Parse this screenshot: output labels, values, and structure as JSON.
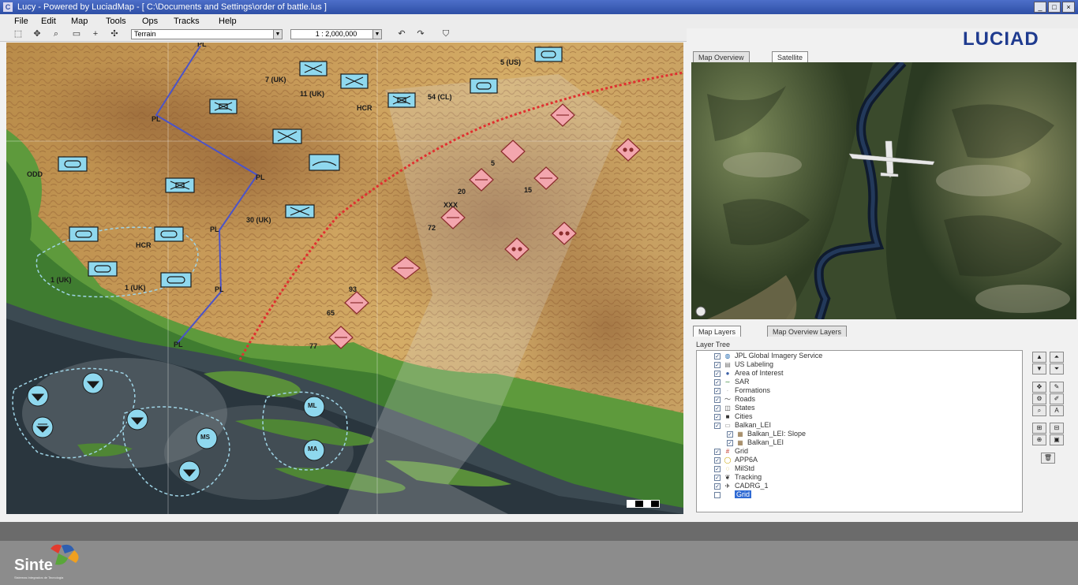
{
  "window": {
    "app_icon": "C",
    "title": "Lucy - Powered by LuciadMap - [ C:\\Documents and Settings\\order of battle.lus ]",
    "controls": [
      "_",
      "□",
      "×"
    ]
  },
  "menu": [
    "File",
    "Edit",
    "Map",
    "Tools",
    "Ops",
    "Tracks",
    "Help"
  ],
  "toolbar": {
    "layer_select": "Terrain",
    "scale_value": "1 : 2,000,000",
    "icons": [
      "select-arrow-icon",
      "pan-hand-icon",
      "zoom-magnifier-icon",
      "measure-icon",
      "crosshair-icon",
      "move-icon",
      "undo-icon",
      "redo-icon",
      "shield-icon"
    ]
  },
  "brand": {
    "logo": "LUCIAD",
    "logo_color": "#1f3b8f",
    "footer_logo": "Sinte",
    "footer_sub": "Sistemas Integrados de Tecnologia"
  },
  "map": {
    "labels": {
      "pl_top": "PL",
      "pl_1": "PL",
      "pl_2": "PL",
      "pl_3": "PL",
      "pl_4": "PL",
      "pl_bottom": "PL",
      "u_7uk": "7 (UK)",
      "u_11uk": "11 (UK)",
      "u_hcr1": "HCR",
      "u_54": "54 (CL)",
      "u_5us": "5 (US)",
      "u_odd": "ODD",
      "u_30uk": "30 (UK)",
      "u_hcr2": "HCR",
      "u_1uk_a": "1 (UK)",
      "u_1uk_b": "1 (UK)",
      "e_5": "5",
      "e_20": "20",
      "e_15": "15",
      "e_xxx": "XXX",
      "e_72": "72",
      "e_93": "93",
      "e_65": "65",
      "e_77": "77",
      "s_ml": "ML",
      "s_ms": "MS",
      "s_ma": "MA"
    },
    "colors": {
      "friendly": "#8fd8ee",
      "hostile": "#f3a6ae",
      "phase_line": "#4b53c8",
      "fscl": "#e03030"
    }
  },
  "right_panel": {
    "view_tabs": [
      "Map Overview",
      "Satellite"
    ],
    "active_view_tab": "Satellite",
    "layer_tabs": [
      "Map Layers",
      "Map Overview Layers"
    ],
    "active_layer_tab": "Map Layers",
    "tree_title": "Layer Tree",
    "layers": [
      {
        "label": "JPL Global Imagery Service",
        "icon": "globe-icon",
        "checked": true,
        "indent": 0
      },
      {
        "label": "US Labeling",
        "icon": "layer-icon",
        "checked": true,
        "indent": 0
      },
      {
        "label": "Area of Interest",
        "icon": "area-icon",
        "checked": true,
        "indent": 0
      },
      {
        "label": "SAR",
        "icon": "line-icon",
        "checked": true,
        "indent": 0
      },
      {
        "label": "Formations",
        "icon": "formation-icon",
        "checked": true,
        "indent": 0
      },
      {
        "label": "Roads",
        "icon": "road-icon",
        "checked": true,
        "indent": 0
      },
      {
        "label": "States",
        "icon": "states-icon",
        "checked": true,
        "indent": 0
      },
      {
        "label": "Cities",
        "icon": "city-icon",
        "checked": true,
        "indent": 0
      },
      {
        "label": "Balkan_LEI",
        "icon": "folder-icon",
        "checked": true,
        "indent": 0
      },
      {
        "label": "Balkan_LEI: Slope",
        "icon": "raster-icon",
        "checked": true,
        "indent": 1
      },
      {
        "label": "Balkan_LEI",
        "icon": "raster-icon",
        "checked": true,
        "indent": 1
      },
      {
        "label": "Grid",
        "icon": "grid-icon",
        "checked": true,
        "indent": 0
      },
      {
        "label": "APP6A",
        "icon": "symbol-icon",
        "checked": true,
        "indent": 0
      },
      {
        "label": "MilStd",
        "icon": "symbol-icon",
        "checked": true,
        "indent": 0
      },
      {
        "label": "Tracking",
        "icon": "tracking-icon",
        "checked": true,
        "indent": 0
      },
      {
        "label": "CADRG_1",
        "icon": "plane-icon",
        "checked": true,
        "indent": 0
      },
      {
        "label": "Grid",
        "icon": "blank-icon",
        "checked": false,
        "indent": 0,
        "selected": true
      }
    ]
  }
}
